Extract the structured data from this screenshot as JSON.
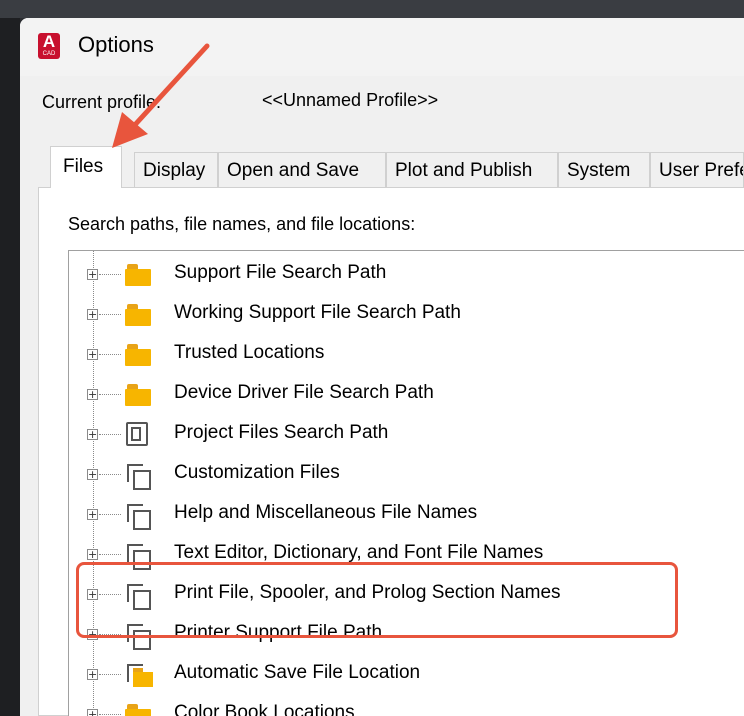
{
  "dialog": {
    "title": "Options",
    "app_icon_letter": "A",
    "app_icon_sub": "CAD"
  },
  "profile": {
    "label": "Current profile:",
    "value": "<<Unnamed Profile>>"
  },
  "tabs": [
    {
      "label": "Files",
      "active": true
    },
    {
      "label": "Display"
    },
    {
      "label": "Open and Save"
    },
    {
      "label": "Plot and Publish"
    },
    {
      "label": "System"
    },
    {
      "label": "User Preferences"
    }
  ],
  "files_panel": {
    "search_label": "Search paths, file names, and file locations:",
    "tree_items": [
      {
        "label": "Support File Search Path",
        "icon": "folder-icon"
      },
      {
        "label": "Working Support File Search Path",
        "icon": "folder-icon"
      },
      {
        "label": "Trusted Locations",
        "icon": "folder-icon"
      },
      {
        "label": "Device Driver File Search Path",
        "icon": "folder-icon"
      },
      {
        "label": "Project Files Search Path",
        "icon": "project-icon"
      },
      {
        "label": "Customization Files",
        "icon": "files-icon"
      },
      {
        "label": "Help and Miscellaneous File Names",
        "icon": "files-icon"
      },
      {
        "label": "Text Editor, Dictionary, and Font File Names",
        "icon": "files-icon"
      },
      {
        "label": "Print File, Spooler, and Prolog Section Names",
        "icon": "files-icon"
      },
      {
        "label": "Printer Support File Path",
        "icon": "files-icon"
      },
      {
        "label": "Automatic Save File Location",
        "icon": "files-folder-icon"
      },
      {
        "label": "Color Book Locations",
        "icon": "folder-icon"
      }
    ],
    "expander_symbol": "+"
  },
  "annotation": {
    "color": "#e8553d"
  }
}
